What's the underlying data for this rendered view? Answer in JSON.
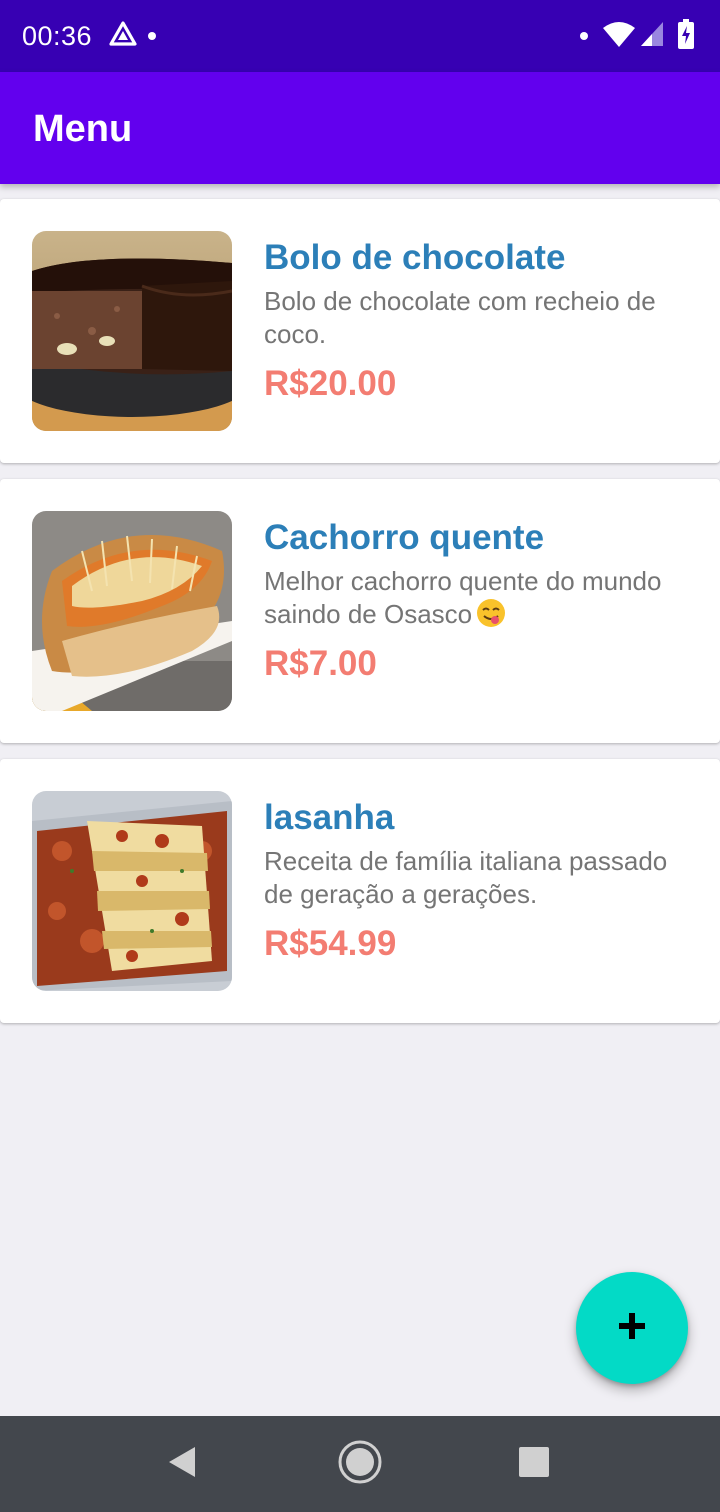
{
  "status_bar": {
    "time": "00:36",
    "icons": [
      "drive-icon",
      "notification-dot",
      "notification-dot",
      "wifi-icon",
      "signal-icon",
      "battery-charging-icon"
    ]
  },
  "app_bar": {
    "title": "Menu",
    "color": "#6200ee"
  },
  "menu": {
    "items": [
      {
        "name": "Bolo de chocolate",
        "description": "Bolo de chocolate com recheio de coco.",
        "price": "R$20.00",
        "image": "chocolate-cake-photo"
      },
      {
        "name": "Cachorro quente",
        "description": "Melhor cachorro quente do mundo saindo de Osasco",
        "emoji": "yum-face-icon",
        "price": "R$7.00",
        "image": "hot-dog-photo"
      },
      {
        "name": "lasanha",
        "description": "Receita de família italiana passado de geração a gerações.",
        "price": "R$54.99",
        "image": "lasagna-photo"
      }
    ]
  },
  "fab": {
    "icon": "plus-icon",
    "color": "#03dac6"
  },
  "nav_bar": {
    "buttons": [
      "back-icon",
      "home-icon",
      "recents-icon"
    ]
  },
  "colors": {
    "status_bar": "#3700b3",
    "name_text": "#2c7fb8",
    "price_text": "#f37d72",
    "description_text": "#757575",
    "background": "#f0eff4"
  }
}
